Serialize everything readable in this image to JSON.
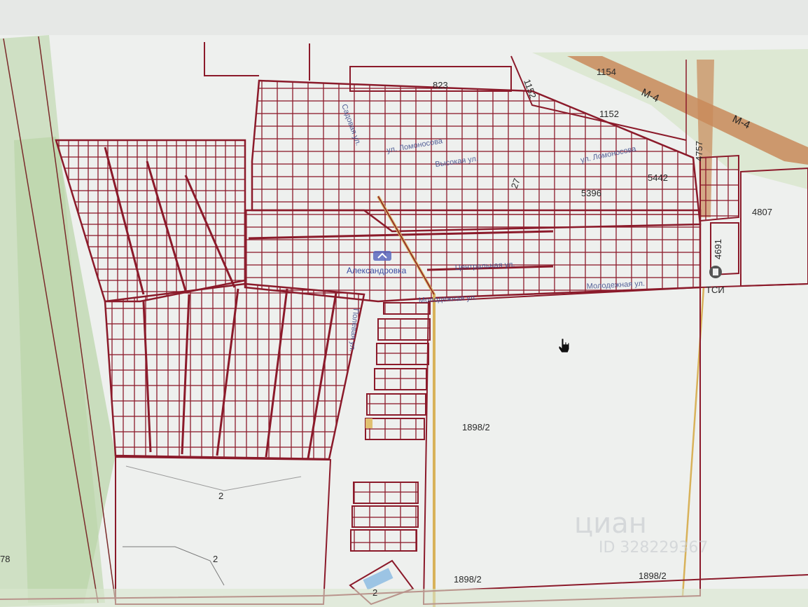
{
  "roads": {
    "highway_upper": "М-4",
    "highway_lower": "М-4"
  },
  "parcels": {
    "p823": "823",
    "p1152_a": "1152",
    "p1154": "1154",
    "p1152_b": "1152",
    "p4757": "4757",
    "p5442": "5442",
    "p5396": "5396",
    "p4807": "4807",
    "p4691": "4691",
    "p27": "27",
    "p1898_a": "1898/2",
    "p1898_b": "1898/2",
    "p1898_c": "1898/2",
    "p2_a": "2",
    "p2_b": "2",
    "p2_c": "2",
    "p78": "78"
  },
  "streets": {
    "lomonosova_1": "ул. Ломоносова",
    "lomonosova_2": "ул. Ломоносова",
    "vysokaya": "Высокая ул.",
    "centralnaya": "Центральная ул.",
    "molodezhnaya_1": "Молодежная ул.",
    "molodezhnaya_2": "Молодежная ул.",
    "sadovaya": "Садовая ул.",
    "polevaya": "Полевая ул."
  },
  "poi": {
    "village": "Александровка",
    "gas_station": "ТСИ"
  },
  "watermark": {
    "brand": "циан",
    "id_text": "ID 328229367"
  },
  "colors": {
    "parcel_line": "#8b1a2a",
    "highway": "#c98a5a",
    "green_strip": "#c6dcb8",
    "background": "#eef0ee"
  },
  "icons": {
    "cursor": "hand-pointer-icon",
    "poi_marker": "map-pin-icon"
  }
}
